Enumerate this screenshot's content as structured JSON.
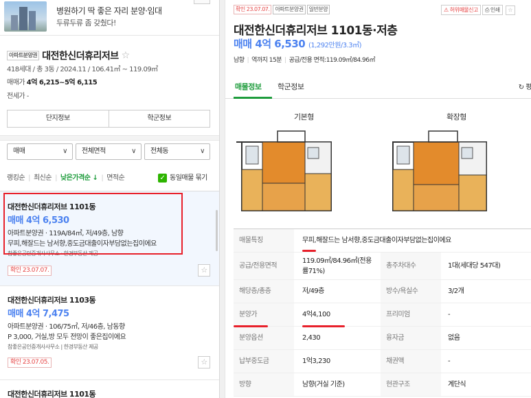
{
  "ad": {
    "line1": "병원하기 딱 좋은 자리 분양·임대",
    "line2": "두류두류 좀 갖췄다!"
  },
  "complex": {
    "type_tag": "아파트분양권",
    "name": "대전한신더휴리저브",
    "star": "☆",
    "meta": "418세대 / 총 3동 / 2024.11 / 106.41㎡ ~ 119.09㎡",
    "sale_label": "매매가",
    "sale_price": "4억 6,215~5억 6,115",
    "jeonse": "전세가 -",
    "buttons": [
      "단지정보",
      "학군정보"
    ]
  },
  "filters": [
    {
      "label": "매매",
      "chevron": "∨"
    },
    {
      "label": "전체면적",
      "chevron": "∨"
    },
    {
      "label": "전체동",
      "chevron": "∨"
    }
  ],
  "sort": {
    "options": [
      "랭킹순",
      "최신순",
      "낮은가격순 ↓",
      "면적순"
    ],
    "active_index": 2,
    "same_listing": "동일매물 묶기",
    "check": "✓"
  },
  "listings": [
    {
      "title": "대전한신더휴리저브 1101동",
      "price": "매매 4억 6,530",
      "spec": "아파트분양권 · 119A/84㎡, 저/49층, 남향",
      "desc": "무피,해잘드는 남서향,중도금대출이자부담없는집이에요",
      "agent": "참좋은공인중개사사무소 · 한경부동산 제공",
      "confirm": "확인 23.07.07.",
      "star": "☆"
    },
    {
      "title": "대전한신더휴리저브 1103동",
      "price": "매매 4억 7,475",
      "spec": "아파트분양권 · 106/75㎡, 저/46층, 남동향",
      "desc": "P 3,000, 거실,방 모두 전망이 좋은집이에요",
      "agent": "참좋은공인중개사사무소 | 한경부동산 제공",
      "confirm": "확인 23.07.05.",
      "star": "☆"
    },
    {
      "title": "대전한신더휴리저브 1101동"
    }
  ],
  "detail": {
    "confirm_tag": "확인 23.07.07.",
    "type_tag": "아파트분양권",
    "kind_tag": "일반분양",
    "report": "허위매물신고",
    "print": "인쇄",
    "star": "☆",
    "title": "대전한신더휴리저브 1101동·저층",
    "price": "매매 4억 6,530",
    "price_unit": "(1,292만원/3.3㎡)",
    "sub": [
      "남향",
      "역까지 15분",
      "공급/전용 면적:119.09㎡/84.96㎡"
    ],
    "tabs": [
      "매물정보",
      "학군정보"
    ],
    "refresh": "↻ 평",
    "floorplans": [
      "기본형",
      "확장형"
    ],
    "table": [
      {
        "k": "매물특징",
        "v": "무피,해잘드는 남서향,중도금대출이자부담없는집이에요"
      },
      {
        "k": "공급/전용면적",
        "v": "119.09㎡/84.96㎡(전용",
        "v_line2": "률71%)",
        "k2": "총주차대수",
        "v2": "1대(세대당 547대)"
      },
      {
        "k": "해당층/총층",
        "v": "저/49층",
        "k2": "방수/욕실수",
        "v2": "3/2개"
      },
      {
        "k": "분양가",
        "v": "4억4,100",
        "k2": "프리미엄",
        "v2": "-"
      },
      {
        "k": "분양옵션",
        "v": "2,430",
        "k2": "융자금",
        "v2": "없음"
      },
      {
        "k": "납부중도금",
        "v": "1억3,230",
        "k2": "채권액",
        "v2": "-"
      },
      {
        "k": "방향",
        "v": "남향(거실 기준)",
        "k2": "현관구조",
        "v2": "계단식"
      }
    ]
  },
  "colors": {
    "accent_green": "#1e9c3c",
    "price_blue": "#4c82f0",
    "highlight_red": "#e8202a"
  }
}
